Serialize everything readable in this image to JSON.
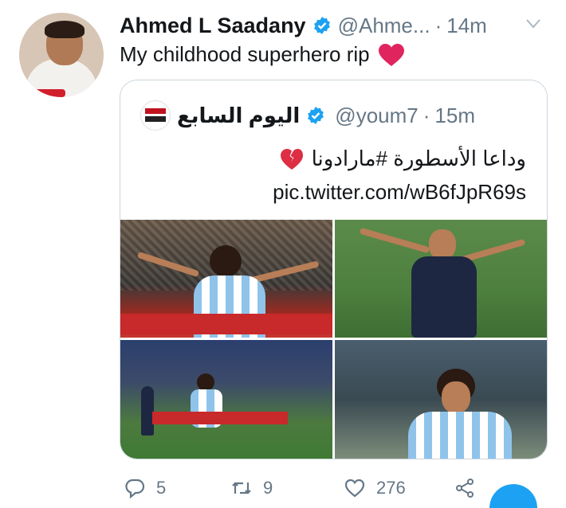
{
  "author": {
    "name": "Ahmed L Saadany",
    "handle": "@Ahme...",
    "time": "14m",
    "separator": "·"
  },
  "tweet": {
    "text": "My childhood superhero rip"
  },
  "quoted": {
    "name": "اليوم السابع",
    "handle": "@youm7",
    "separator": "·",
    "time": "15m",
    "text": "وداعا الأسطورة #مارادونا",
    "link": "pic.twitter.com/wB6fJpR69s"
  },
  "actions": {
    "reply_count": "5",
    "retweet_count": "9",
    "like_count": "276"
  },
  "colors": {
    "verified": "#1da1f2",
    "heart": "#e0245e",
    "muted": "#657786",
    "border": "#ccd6dd"
  },
  "icons": [
    "verified-badge-icon",
    "chevron-down-icon",
    "red-heart-emoji-icon",
    "broken-heart-emoji-icon",
    "reply-icon",
    "retweet-icon",
    "like-icon",
    "share-icon"
  ]
}
